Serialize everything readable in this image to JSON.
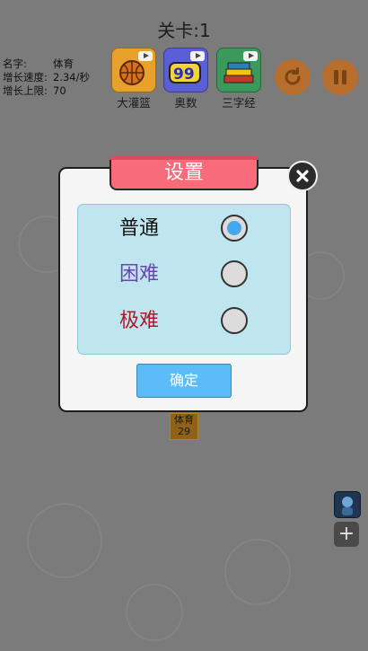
{
  "header": {
    "level_title": "关卡:1"
  },
  "info": {
    "name_label": "名字:",
    "name_value": "体育",
    "speed_label": "增长速度:",
    "speed_value": "2.34/秒",
    "limit_label": "增长上限:",
    "limit_value": "70"
  },
  "apps": [
    {
      "label": "大灌篮",
      "icon": "basketball-icon",
      "color": "#e8a12a"
    },
    {
      "label": "奥数",
      "icon": "math-icon",
      "color": "#5b5fd6"
    },
    {
      "label": "三字经",
      "icon": "books-icon",
      "color": "#3b9a5b"
    }
  ],
  "tile": {
    "name": "体育",
    "value": "29"
  },
  "dialog": {
    "title": "设置",
    "options": [
      {
        "label": "普通",
        "color": "#111111",
        "selected": true
      },
      {
        "label": "困难",
        "color": "#6a44b0",
        "selected": false
      },
      {
        "label": "极难",
        "color": "#b0182a",
        "selected": false
      }
    ],
    "confirm_label": "确定"
  }
}
